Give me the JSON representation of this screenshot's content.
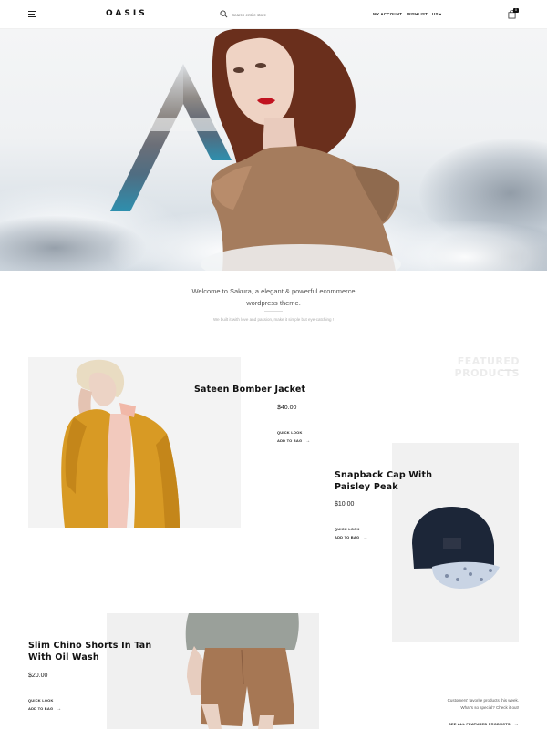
{
  "header": {
    "logo": "OASIS",
    "search_placeholder": "Search entire store",
    "nav": [
      "MY ACCOUNT",
      "WISHLIST",
      "US"
    ],
    "cart_count": "0"
  },
  "welcome": {
    "line1": "Welcome to Sakura, a elegant & powerful ecommerce",
    "line2": "wordpress theme.",
    "sub": "We built it with love and passion, make it simple but eye-catching !"
  },
  "featured": {
    "title": "FEATURED PRODUCTS"
  },
  "products": [
    {
      "name_line1": "Sateen Bomber Jacket",
      "name_line2": "",
      "price": "$40.00",
      "quick": "QUICK LOOK",
      "add": "ADD TO BAG"
    },
    {
      "name_line1": "Snapback Cap With",
      "name_line2": "Paisley Peak",
      "price": "$10.00",
      "quick": "QUICK LOOK",
      "add": "ADD TO BAG"
    },
    {
      "name_line1": "Slim Chino Shorts In Tan",
      "name_line2": "With Oil Wash",
      "price": "$20.00",
      "quick": "QUICK LOOK",
      "add": "ADD TO BAG"
    }
  ],
  "promo": {
    "line1": "Customers' favorite products this week.",
    "line2": "What's so special? Check it out!",
    "see_all": "SEE ALL FEATURED PRODUCTS"
  },
  "icons": {
    "menu": "hamburger-icon",
    "search": "search-icon",
    "cart": "bag-icon",
    "arrow": "arrow-right-icon"
  }
}
